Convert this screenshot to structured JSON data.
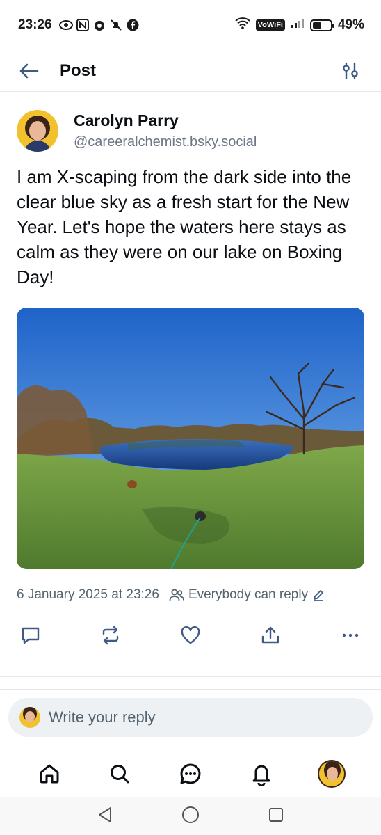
{
  "status_bar": {
    "time": "23:26",
    "network": "VoWiFi",
    "battery": "49%",
    "battery_level": 0.49
  },
  "header": {
    "title": "Post"
  },
  "post": {
    "author": {
      "name": "Carolyn Parry",
      "handle": "@careeralchemist.bsky.social"
    },
    "text": "I am X-scaping from the dark side into the clear blue sky as a fresh start for the New Year. Let's hope the waters here stays as calm as they were on our lake on Boxing Day!",
    "timestamp": "6 January 2025 at 23:26",
    "reply_permission": "Everybody can reply"
  },
  "actions": [
    "reply-icon",
    "repost-icon",
    "like-icon",
    "share-icon",
    "more-icon"
  ],
  "reply_box": {
    "placeholder": "Write your reply"
  },
  "bottom_nav": [
    "home-icon",
    "search-icon",
    "chat-icon",
    "notifications-icon",
    "profile-avatar"
  ],
  "colors": {
    "accent": "#3f5b84",
    "text": "#0b0f14",
    "muted": "#536471",
    "avatar_bg": "#f2c12e"
  }
}
